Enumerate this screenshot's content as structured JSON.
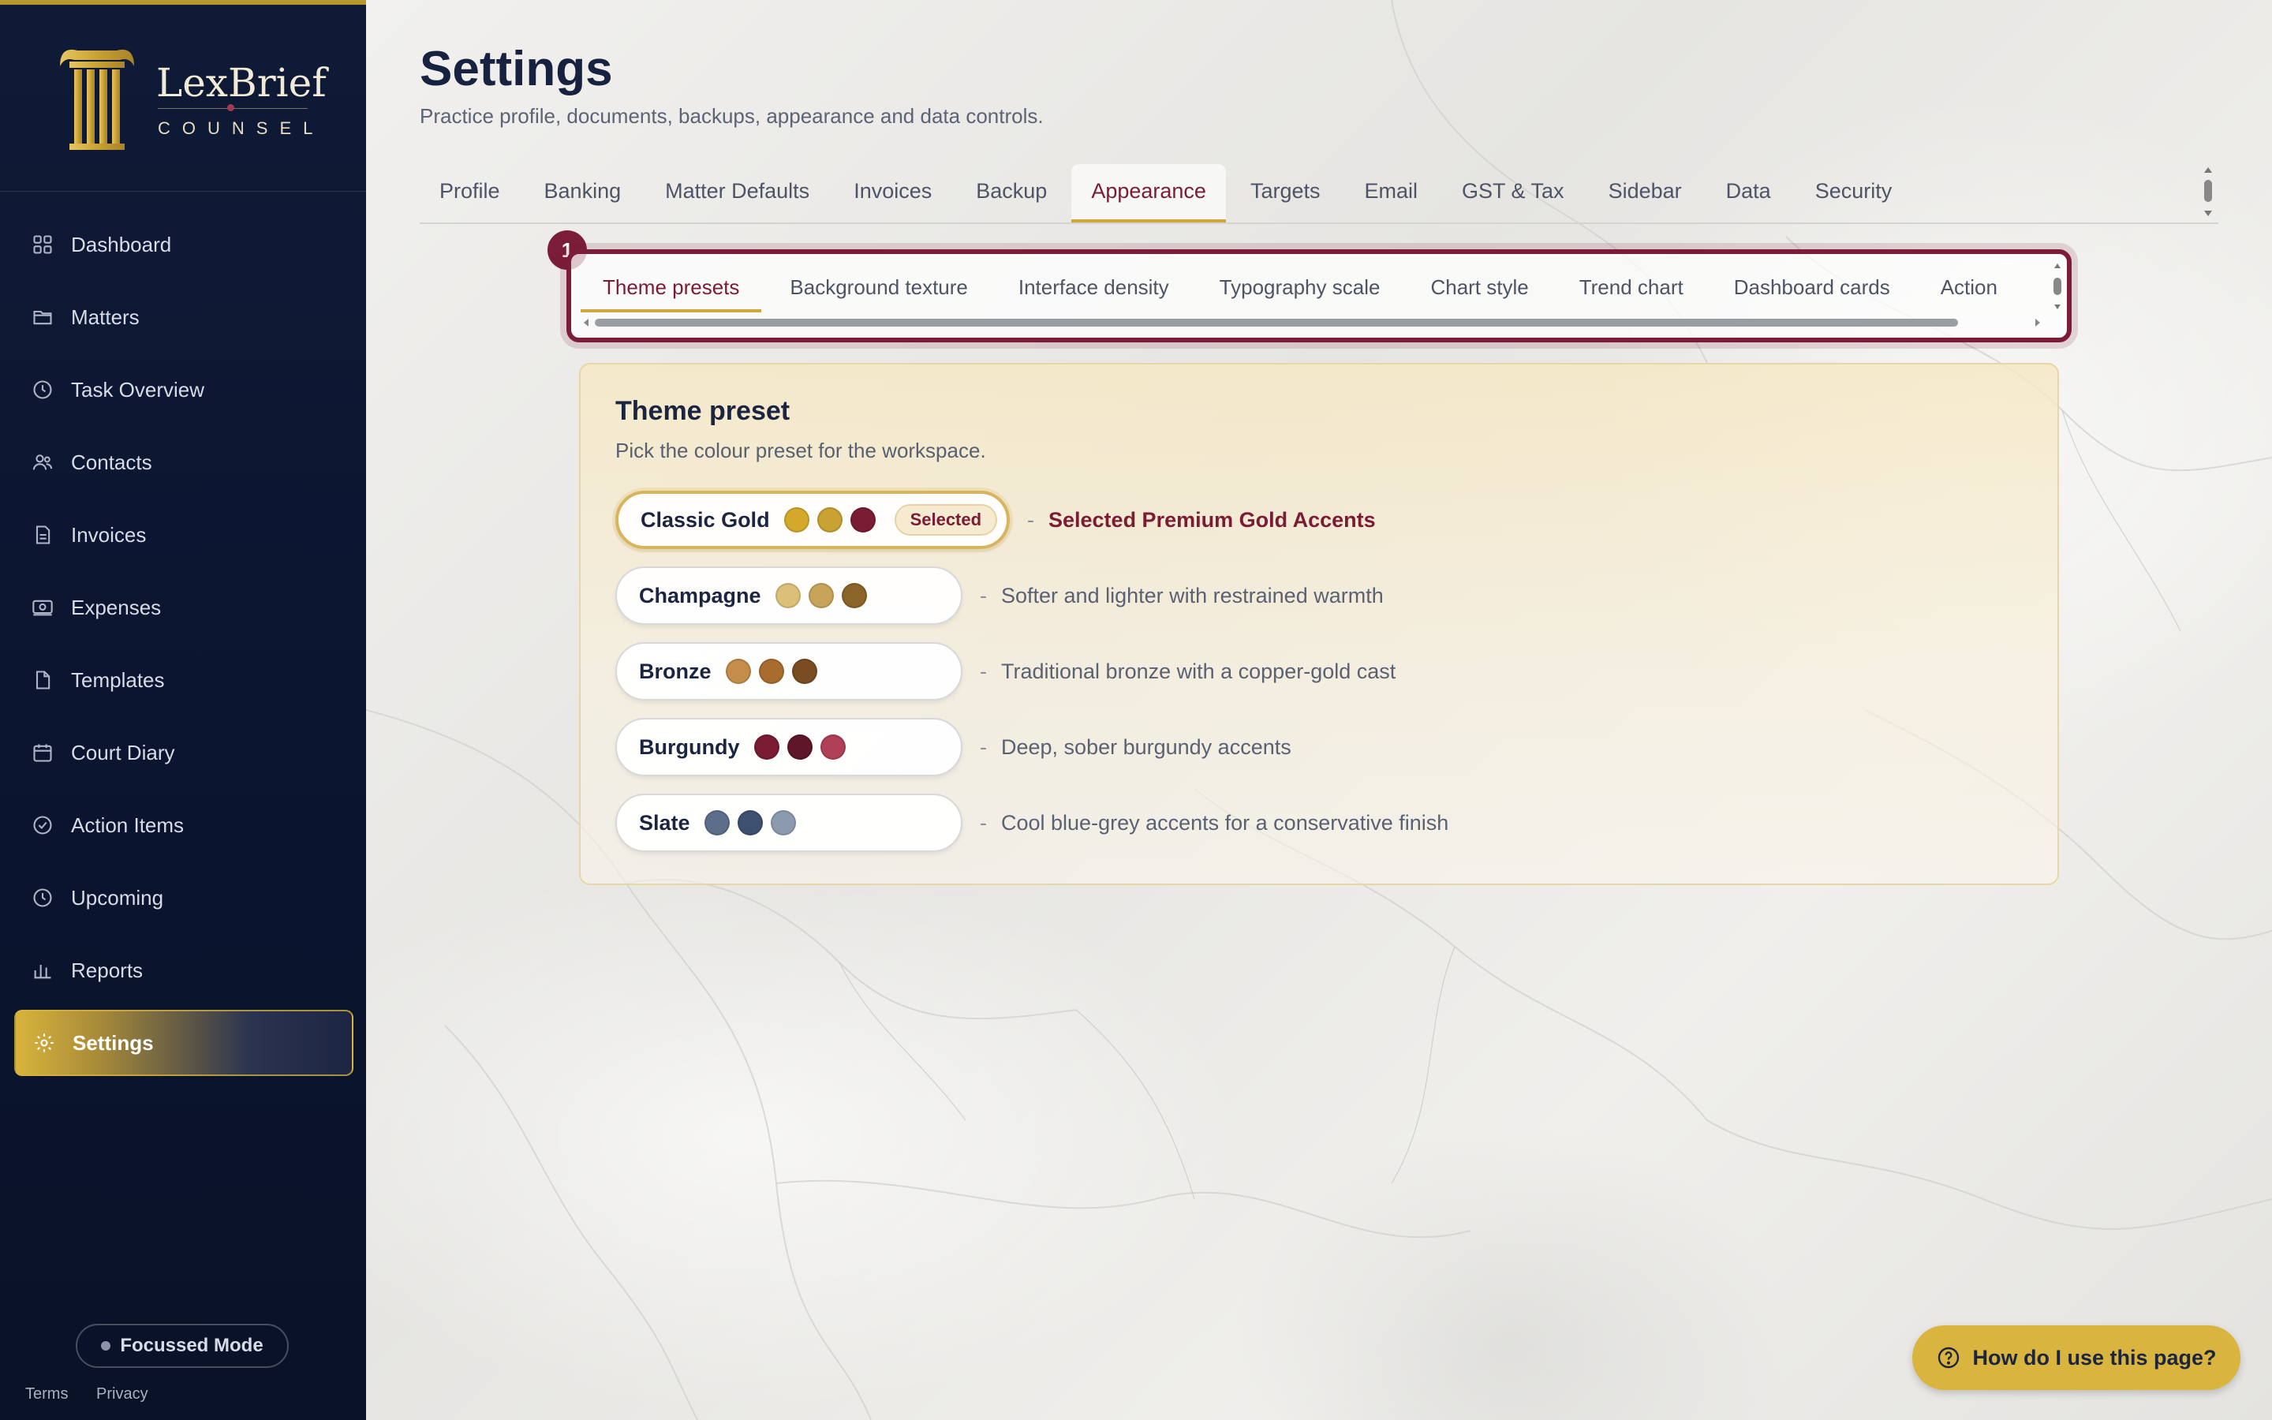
{
  "brand": {
    "name": "LexBrief",
    "sub": "COUNSEL"
  },
  "sidebar": {
    "items": [
      {
        "label": "Dashboard",
        "icon": "grid-icon"
      },
      {
        "label": "Matters",
        "icon": "folder-icon"
      },
      {
        "label": "Task Overview",
        "icon": "clock-icon"
      },
      {
        "label": "Contacts",
        "icon": "users-icon"
      },
      {
        "label": "Invoices",
        "icon": "document-icon"
      },
      {
        "label": "Expenses",
        "icon": "cash-icon"
      },
      {
        "label": "Templates",
        "icon": "file-icon"
      },
      {
        "label": "Court Diary",
        "icon": "calendar-icon"
      },
      {
        "label": "Action Items",
        "icon": "check-circle-icon"
      },
      {
        "label": "Upcoming",
        "icon": "clock-icon"
      },
      {
        "label": "Reports",
        "icon": "bar-chart-icon"
      },
      {
        "label": "Settings",
        "icon": "gear-icon",
        "active": true
      }
    ],
    "focus_mode": "Focussed Mode",
    "terms": "Terms",
    "privacy": "Privacy"
  },
  "page": {
    "title": "Settings",
    "subtitle": "Practice profile, documents, backups, appearance and data controls."
  },
  "tabs": [
    "Profile",
    "Banking",
    "Matter Defaults",
    "Invoices",
    "Backup",
    "Appearance",
    "Targets",
    "Email",
    "GST & Tax",
    "Sidebar",
    "Data",
    "Security"
  ],
  "active_tab": "Appearance",
  "marker": "1",
  "subtabs": [
    "Theme presets",
    "Background texture",
    "Interface density",
    "Typography scale",
    "Chart style",
    "Trend chart",
    "Dashboard cards",
    "Action"
  ],
  "active_subtab": "Theme presets",
  "card": {
    "title": "Theme preset",
    "subtitle": "Pick the colour preset for the workspace.",
    "presets": [
      {
        "name": "Classic Gold",
        "colors": [
          "#d4a82a",
          "#c9a233",
          "#7a1c34"
        ],
        "selected": true,
        "badge": "Selected",
        "description": "Selected Premium Gold Accents"
      },
      {
        "name": "Champagne",
        "colors": [
          "#dcc07a",
          "#c8a45a",
          "#8a6428"
        ],
        "description": "Softer and lighter with restrained warmth"
      },
      {
        "name": "Bronze",
        "colors": [
          "#c48d4a",
          "#a86c2e",
          "#7a4c22"
        ],
        "description": "Traditional bronze with a copper-gold cast"
      },
      {
        "name": "Burgundy",
        "colors": [
          "#7a1c34",
          "#5e1628",
          "#b04058"
        ],
        "description": "Deep, sober burgundy accents"
      },
      {
        "name": "Slate",
        "colors": [
          "#5c6e8a",
          "#3e5070",
          "#8c9ab0"
        ],
        "description": "Cool blue-grey accents for a conservative finish"
      }
    ]
  },
  "help": {
    "label": "How do I use this page?"
  },
  "colors": {
    "accent_gold": "#d9b43f",
    "burgundy": "#7b1d38",
    "navy": "#0f1a36"
  }
}
